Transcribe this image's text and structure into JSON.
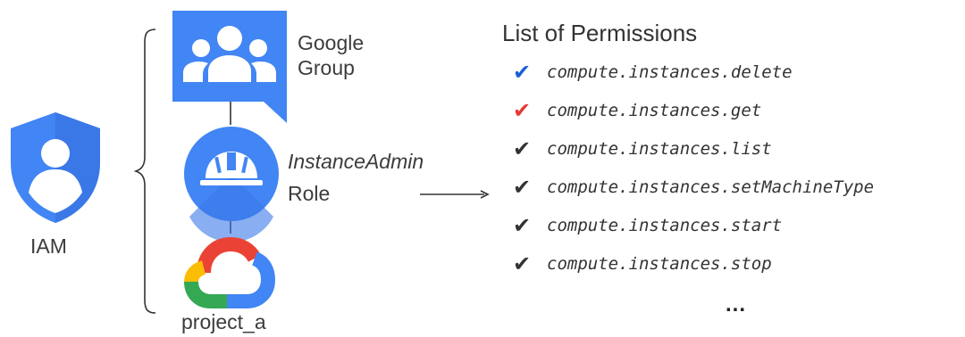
{
  "iam": {
    "label": "IAM"
  },
  "google_group": {
    "label_line1": "Google",
    "label_line2": "Group"
  },
  "role": {
    "name": "InstanceAdmin",
    "suffix": "Role"
  },
  "project": {
    "label": "project_a"
  },
  "permissions": {
    "title": "List of Permissions",
    "items": [
      {
        "name": "compute.instances.delete",
        "check_color": "#1a5fd6"
      },
      {
        "name": "compute.instances.get",
        "check_color": "#e53935"
      },
      {
        "name": "compute.instances.list",
        "check_color": "#333333"
      },
      {
        "name": "compute.instances.setMachineType",
        "check_color": "#333333"
      },
      {
        "name": "compute.instances.start",
        "check_color": "#333333"
      },
      {
        "name": "compute.instances.stop",
        "check_color": "#333333"
      }
    ],
    "more": "..."
  },
  "colors": {
    "iam_blue": "#4285f4",
    "group_blue": "#4285f4",
    "role_blue": "#4285f4",
    "gcp_red": "#ea4335",
    "gcp_yellow": "#fbbc04",
    "gcp_green": "#34a853",
    "gcp_blue": "#4285f4"
  },
  "icons": [
    "iam-shield-icon",
    "google-group-icon",
    "instance-admin-hardhat-icon",
    "google-cloud-icon"
  ]
}
